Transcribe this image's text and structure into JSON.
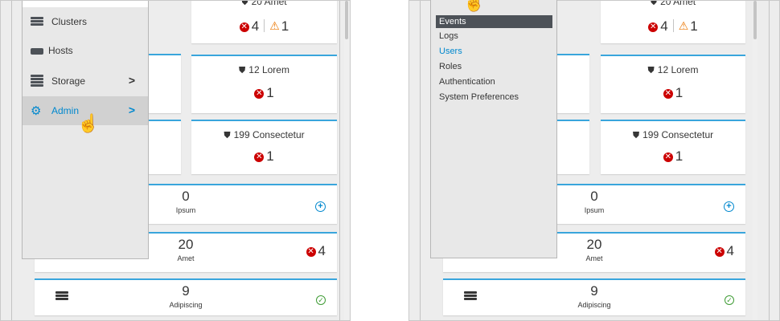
{
  "colors": {
    "accent": "#39a5dc",
    "error": "#cc0000",
    "warning": "#ec7a08",
    "success": "#3f9c35",
    "link": "#0088ce",
    "pointer": "#e000c8"
  },
  "nav": {
    "items": [
      {
        "label": "Clusters",
        "icon": "clusters-icon"
      },
      {
        "label": "Hosts",
        "icon": "hosts-icon"
      },
      {
        "label": "Storage",
        "icon": "storage-icon",
        "chevron": ">"
      },
      {
        "label": "Admin",
        "icon": "gear-icon",
        "chevron": ">",
        "hover": true
      }
    ]
  },
  "admin_menu": {
    "items": [
      "Events",
      "Logs",
      "Users",
      "Roles",
      "Authentication",
      "System Preferences"
    ],
    "active": "Events",
    "hover": "Users"
  },
  "cards": {
    "amet": {
      "title": "20 Amet",
      "errors": "4",
      "warnings": "1"
    },
    "lorem": {
      "title": "12 Lorem",
      "errors": "1"
    },
    "consectetur": {
      "title": "199 Consectetur",
      "errors": "1"
    },
    "ipsum": {
      "count": "0",
      "label": "Ipsum",
      "action": "add-icon"
    },
    "amet_wide": {
      "count": "20",
      "label": "Amet",
      "errors": "4"
    },
    "adipiscing": {
      "count": "9",
      "label": "Adipiscing",
      "status": "ok-icon"
    }
  },
  "icons": {
    "shield": "shield-icon",
    "error": "error-circle-icon",
    "warning": "warning-triangle-icon",
    "server": "server-icon",
    "pointer": "hand-pointer-icon"
  }
}
